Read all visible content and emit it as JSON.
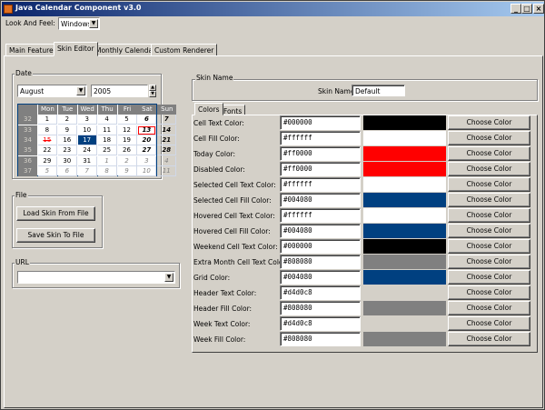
{
  "window": {
    "title": "Java Calendar Component v3.0",
    "minimize": "_",
    "maximize": "□",
    "close": "×"
  },
  "laf": {
    "label": "Look And Feel:",
    "value": "Windows"
  },
  "tabs": [
    {
      "label": "Main Features"
    },
    {
      "label": "Skin Editor"
    },
    {
      "label": "Monthly Calendar"
    },
    {
      "label": "Custom Renderer"
    }
  ],
  "date": {
    "group_label": "Date",
    "month": "August",
    "year": "2005",
    "day_headers": [
      "Mon",
      "Tue",
      "Wed",
      "Thu",
      "Fri",
      "Sat",
      "Sun"
    ],
    "weeks": [
      {
        "week": "32",
        "days": [
          "1",
          "2",
          "3",
          "4",
          "5",
          "6",
          "7"
        ]
      },
      {
        "week": "33",
        "days": [
          "8",
          "9",
          "10",
          "11",
          "12",
          "13",
          "14"
        ]
      },
      {
        "week": "34",
        "days": [
          "15",
          "16",
          "17",
          "18",
          "19",
          "20",
          "21"
        ]
      },
      {
        "week": "35",
        "days": [
          "22",
          "23",
          "24",
          "25",
          "26",
          "27",
          "28"
        ]
      },
      {
        "week": "36",
        "days": [
          "29",
          "30",
          "31",
          "1",
          "2",
          "3",
          "4"
        ]
      },
      {
        "week": "37",
        "days": [
          "5",
          "6",
          "7",
          "8",
          "9",
          "10",
          "11"
        ]
      }
    ]
  },
  "file": {
    "group_label": "File",
    "load_label": "Load Skin From File",
    "save_label": "Save Skin To File"
  },
  "url": {
    "group_label": "URL",
    "value": ""
  },
  "skin": {
    "group_label": "Skin Name",
    "name_label": "Skin Name:",
    "name_value": "Default"
  },
  "subtabs": [
    {
      "label": "Colors"
    },
    {
      "label": "Fonts"
    }
  ],
  "choose_label": "Choose Color",
  "colors": [
    {
      "label": "Cell Text Color:",
      "value": "#000000",
      "swatch": "#000000"
    },
    {
      "label": "Cell Fill Color:",
      "value": "#ffffff",
      "swatch": "#ffffff"
    },
    {
      "label": "Today Color:",
      "value": "#ff0000",
      "swatch": "#ff0000"
    },
    {
      "label": "Disabled Color:",
      "value": "#ff0000",
      "swatch": "#ff0000"
    },
    {
      "label": "Selected Cell Text Color:",
      "value": "#ffffff",
      "swatch": "#ffffff"
    },
    {
      "label": "Selected Cell Fill Color:",
      "value": "#004080",
      "swatch": "#004080"
    },
    {
      "label": "Hovered Cell Text Color:",
      "value": "#ffffff",
      "swatch": "#ffffff"
    },
    {
      "label": "Hovered Cell Fill Color:",
      "value": "#004080",
      "swatch": "#004080"
    },
    {
      "label": "Weekend Cell Text Color:",
      "value": "#000000",
      "swatch": "#000000"
    },
    {
      "label": "Extra Month Cell Text Color:",
      "value": "#808080",
      "swatch": "#808080"
    },
    {
      "label": "Grid Color:",
      "value": "#004080",
      "swatch": "#004080"
    },
    {
      "label": "Header Text Color:",
      "value": "#d4d0c8",
      "swatch": "#d4d0c8"
    },
    {
      "label": "Header Fill Color:",
      "value": "#808080",
      "swatch": "#808080"
    },
    {
      "label": "Week Text Color:",
      "value": "#d4d0c8",
      "swatch": "#d4d0c8"
    },
    {
      "label": "Week Fill Color:",
      "value": "#808080",
      "swatch": "#808080"
    }
  ]
}
